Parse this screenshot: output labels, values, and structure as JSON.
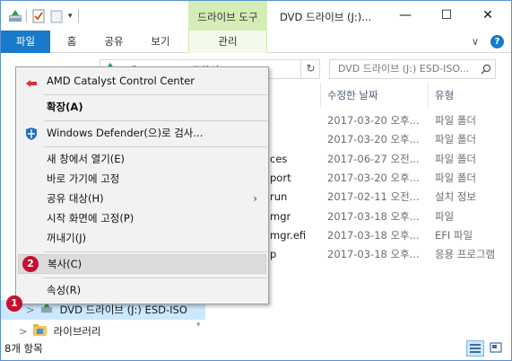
{
  "titlebar": {
    "drive_tools_label": "드라이브 도구",
    "title": "DVD 드라이브 (J:)...",
    "minimize_glyph": "—",
    "maximize_glyph": "☐",
    "close_glyph": "✕"
  },
  "ribbon": {
    "tabs": [
      {
        "label": "파일"
      },
      {
        "label": "홈"
      },
      {
        "label": "공유"
      },
      {
        "label": "보기"
      },
      {
        "label": "관리"
      }
    ],
    "help_glyph": "?",
    "expand_glyph": "∨"
  },
  "addressbar": {
    "path_fragment": "내 PC  >  DVD 드라이...",
    "refresh_glyph": "↻",
    "search_placeholder": "DVD 드라이브 (J:) ESD-ISO..."
  },
  "file_list": {
    "columns": [
      "수정한 날짜",
      "유형"
    ],
    "rows": [
      {
        "name": "",
        "date": "2017-03-20 오후...",
        "type": "파일 폴더"
      },
      {
        "name": "",
        "date": "2017-03-20 오후...",
        "type": "파일 폴더"
      },
      {
        "name": "ces",
        "date": "2017-06-27 오전...",
        "type": "파일 폴더"
      },
      {
        "name": "port",
        "date": "2017-03-20 오후...",
        "type": "파일 폴더"
      },
      {
        "name": "run",
        "date": "2017-02-11 오전...",
        "type": "설치 정보"
      },
      {
        "name": "mgr",
        "date": "2017-03-18 오후...",
        "type": "파일"
      },
      {
        "name": "mgr.efi",
        "date": "2017-03-18 오후...",
        "type": "EFI 파일"
      },
      {
        "name": "p",
        "date": "2017-03-18 오후...",
        "type": "응용 프로그램"
      }
    ]
  },
  "nav": {
    "dvd_label": "DVD 드라이브 (J:) ESD-ISO",
    "libraries_label": "라이브러리",
    "expand_glyph": ">"
  },
  "status": {
    "item_count": "8개 항목"
  },
  "context_menu": {
    "items": [
      {
        "label": "AMD Catalyst Control Center",
        "bold": false
      },
      {
        "label": "확장(A)",
        "bold": true
      },
      {
        "label": "Windows Defender(으)로 검사...",
        "bold": false
      },
      {
        "label": "새 창에서 열기(E)",
        "bold": false
      },
      {
        "label": "바로 가기에 고정",
        "bold": false
      },
      {
        "label": "공유 대상(H)",
        "bold": false,
        "submenu": true
      },
      {
        "label": "시작 화면에 고정(P)",
        "bold": false
      },
      {
        "label": "꺼내기(J)",
        "bold": false
      },
      {
        "label": "복사(C)",
        "bold": false,
        "highlighted": true
      },
      {
        "label": "속성(R)",
        "bold": false
      }
    ],
    "submenu_arrow": "›"
  },
  "badges": {
    "step1": "1",
    "step2": "2"
  },
  "colors": {
    "accent": "#1979ca",
    "drive_tools": "#d4ecb5",
    "badge": "#c8102e",
    "selection": "#cce8ff"
  }
}
